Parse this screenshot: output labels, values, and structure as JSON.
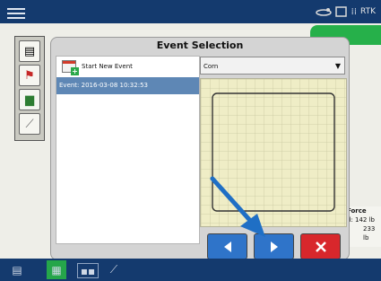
{
  "dialog": {
    "title": "Event Selection",
    "new_event_label": "Start New Event",
    "selected_event": "Event: 2016-03-08 10:32:53",
    "crop_value": "Corn"
  },
  "right_panel": {
    "line1": "Force",
    "line2": "d:  142 lb",
    "line3": "233 lb"
  },
  "status": {
    "gps_text": "RTK"
  },
  "colors": {
    "topbar": "#143a6e",
    "dialog_bg": "#d4d4d4",
    "selected_row": "#5e87b5",
    "next_button": "#2f74c9",
    "cancel_button": "#d8272c",
    "annotation_arrow": "#1f6fc5"
  },
  "icons": {
    "prev": "left-arrow-icon",
    "next": "right-arrow-icon",
    "cancel": "close-icon"
  }
}
